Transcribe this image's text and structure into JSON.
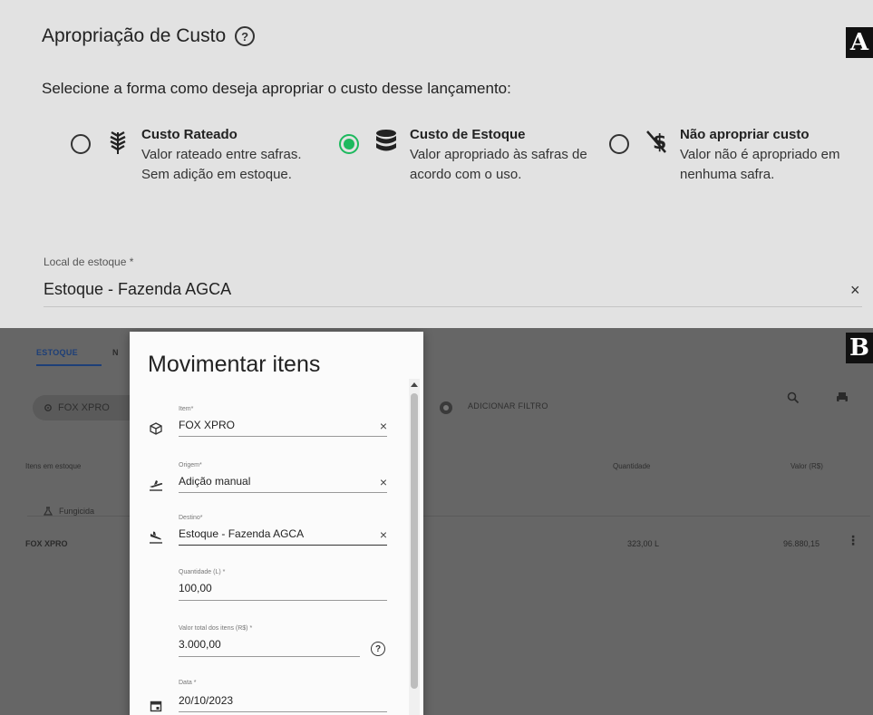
{
  "panel_a": {
    "letter": "A",
    "title": "Apropriação de Custo",
    "help_icon_glyph": "?",
    "subtitle": "Selecione a forma como deseja apropriar o custo desse lançamento:",
    "options": [
      {
        "icon": "wheat-icon",
        "title": "Custo Rateado",
        "description": "Valor rateado entre safras. Sem adição em estoque.",
        "selected": false
      },
      {
        "icon": "database-icon",
        "title": "Custo de Estoque",
        "description": "Valor apropriado às safras de acordo com o uso.",
        "selected": true
      },
      {
        "icon": "money-off-icon",
        "title": "Não apropriar custo",
        "description": "Valor não é apropriado em nenhuma safra.",
        "selected": false
      }
    ],
    "local_estoque": {
      "label": "Local de estoque *",
      "value": "Estoque - Fazenda AGCA",
      "clear": "×"
    }
  },
  "panel_b": {
    "letter": "B",
    "tab_active": "ESTOQUE",
    "tab_second_stub": "N",
    "filter_chip": "FOX XPRO",
    "add_filter": "ADICIONAR FILTRO",
    "columns": {
      "itens": "Itens em estoque",
      "quantidade": "Quantidade",
      "valor": "Valor (R$)"
    },
    "group": "Fungicida",
    "row": {
      "name": "FOX XPRO",
      "quantidade": "323,00 L",
      "valor": "96.880,15",
      "menu": "⋮"
    },
    "dialog": {
      "title": "Movimentar itens",
      "fields": {
        "item": {
          "label": "Item*",
          "value": "FOX XPRO",
          "clear": "×"
        },
        "origem": {
          "label": "Origem*",
          "value": "Adição manual",
          "clear": "×"
        },
        "destino": {
          "label": "Destino*",
          "value": "Estoque - Fazenda AGCA",
          "clear": "×"
        },
        "quantidade": {
          "label": "Quantidade (L) *",
          "value": "100,00"
        },
        "valor_total": {
          "label": "Valor total dos itens (R$) *",
          "value": "3.000,00",
          "help": "?"
        },
        "data": {
          "label": "Data *",
          "value": "20/10/2023"
        }
      }
    }
  },
  "colors": {
    "panel_a_bg": "#e2e2e2",
    "panel_b_bg": "#666666",
    "radio_selected": "#1db95e",
    "tab_active": "#1d3f78"
  }
}
